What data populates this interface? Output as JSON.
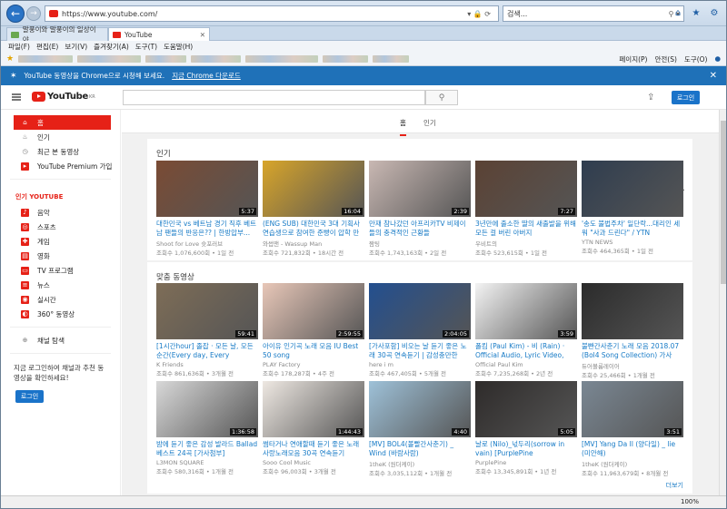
{
  "browser": {
    "url": "https://www.youtube.com/",
    "search_placeholder": "검색...",
    "tabs": [
      {
        "label": "말풍이와 말풍이의 일상이야..."
      },
      {
        "label": "YouTube"
      }
    ],
    "menu": [
      "파일(F)",
      "편집(E)",
      "보기(V)",
      "즐겨찾기(A)",
      "도구(T)",
      "도움말(H)"
    ],
    "favorites_tools": [
      "페이지(P)",
      "안전(S)",
      "도구(O)"
    ],
    "zoom": "100%"
  },
  "chrome_banner": {
    "text": "YouTube 동영상을 Chrome으로 시청해 보세요.",
    "link": "지금 Chrome 다운로드"
  },
  "header": {
    "logo": "YouTube",
    "logo_region": "KR",
    "login": "로그인"
  },
  "sidebar": {
    "main_items": [
      {
        "label": "홈",
        "icon": "home-icon"
      },
      {
        "label": "인기",
        "icon": "fire-icon"
      },
      {
        "label": "최근 본 동영상",
        "icon": "history-icon"
      },
      {
        "label": "YouTube Premium 가입",
        "icon": "youtube-icon"
      }
    ],
    "section_title": "인기 YOUTUBE",
    "popular_items": [
      {
        "label": "음악",
        "icon": "music-icon"
      },
      {
        "label": "스포츠",
        "icon": "sports-icon"
      },
      {
        "label": "게임",
        "icon": "game-icon"
      },
      {
        "label": "영화",
        "icon": "film-icon"
      },
      {
        "label": "TV 프로그램",
        "icon": "tv-icon"
      },
      {
        "label": "뉴스",
        "icon": "news-icon"
      },
      {
        "label": "실시간",
        "icon": "live-icon"
      },
      {
        "label": "360° 동영상",
        "icon": "360-icon"
      }
    ],
    "browse_channels": "채널 탐색",
    "signin_text": "지금 로그인하여 채널과 추천 동영상을 확인하세요!",
    "signin_button": "로그인"
  },
  "home_tabs": [
    "홈",
    "인기"
  ],
  "sections": [
    {
      "title": "인기",
      "videos": [
        {
          "title": "대한민국 vs 베트남 경기 직후 베트남 팬들의 반응은?? | 한방압부...",
          "channel": "Shoot for Love 슛포러브",
          "meta": "조회수 1,076,600회 • 1일 전",
          "duration": "5:37",
          "color": "#7a4b34"
        },
        {
          "title": "(ENG SUB) 대한민국 3대 기획사 연습생으로 참여한 준빵이 압학 만남...",
          "channel": "와썹맨 - Wassup Man",
          "meta": "조회수 721,832회 • 18시간 전",
          "duration": "16:04",
          "color": "#d8a52a"
        },
        {
          "title": "만재 참나갔던 아프리카TV 비제이 들의 충격적인 근황들",
          "channel": "짬팅",
          "meta": "조회수 1,743,163회 • 2일 전",
          "duration": "2:39",
          "color": "#c9b8b3"
        },
        {
          "title": "3년만에 출소한 딸의 새출발을 위해 모든 걸 버린 아버지",
          "channel": "우비트의",
          "meta": "조회수 523,615회 • 1일 전",
          "duration": "7:27",
          "color": "#5b4234"
        },
        {
          "title": "'송도 불법주차' 일단락...대리인 세워 \"사과 드린다\" / YTN",
          "channel": "YTN NEWS",
          "meta": "조회수 464,365회 • 1일 전",
          "duration": "",
          "color": "#2f3d4f"
        }
      ]
    },
    {
      "title": "맞춤 동영상",
      "videos": [
        {
          "title": "[1시간hour] 졸잡 · 모든 날, 모든 순간(Every day, Every Moment) ...",
          "channel": "K Friends",
          "meta": "조회수 861,636회 • 3개월 전",
          "duration": "59:41",
          "color": "#7e6d57"
        },
        {
          "title": "아이유 인기곡 노래 모음 IU Best 50 song",
          "channel": "PLAY Factory",
          "meta": "조회수 178,287회 • 4주 전",
          "duration": "2:59:55",
          "color": "#e8c7b8"
        },
        {
          "title": "[가사포함] 비오는 날 듣기 좋은 노래 30곡 연속듣기 | 감성충만한 분...",
          "channel": "here i m",
          "meta": "조회수 467,405회 • 5개월 전",
          "duration": "2:04:05",
          "color": "#234f8f"
        },
        {
          "title": "폴킴 (Paul Kim) - 비 (Rain) · Official Audio, Lyric Video, ENG ...",
          "channel": "Official Paul Kim",
          "meta": "조회수 7,235,268회 • 2년 전",
          "duration": "3:59",
          "color": "#f3f3f3"
        },
        {
          "title": "불빤간사춘기 노래 모음 2018.07 (Bol4 Song Collection) 가사+37...",
          "channel": "듀어볼륨레이어",
          "meta": "조회수 25,466회 • 1개월 전",
          "duration": "",
          "color": "#2b2b2b"
        },
        {
          "title": "밤에 듣기 좋은 감성 발라드 Ballad 베스트 24곡 [가사첨부]",
          "channel": "L3MON SQUARE",
          "meta": "조회수 580,316회 • 1개월 전",
          "duration": "1:36:58",
          "color": "#d8d8d8"
        },
        {
          "title": "썸타거나 연애할때 듣기 좋은 노래 사랑노래모음 30곡 연속듣기",
          "channel": "Sooo Cool Music",
          "meta": "조회수 96,003회 • 3개월 전",
          "duration": "1:44:43",
          "color": "#eee8e2"
        },
        {
          "title": "[MV] BOL4(볼빨간사춘기) _ Wind (바람사람)",
          "channel": "1theK (원더케이)",
          "meta": "조회수 3,035,112회 • 1개월 전",
          "duration": "4:40",
          "color": "#9ec1d8"
        },
        {
          "title": "날로 (Nilo)_넋두리(sorrow in vain) [PurplePine Entertainment]",
          "channel": "PurplePine",
          "meta": "조회수 13,345,891회 • 1년 전",
          "duration": "5:05",
          "color": "#2e2b2a"
        },
        {
          "title": "[MV] Yang Da Il (양다일) _ lie (미안해)",
          "channel": "1theK (원더케이)",
          "meta": "조회수 11,963,679회 • 8개월 전",
          "duration": "3:51",
          "color": "#7a8793"
        }
      ],
      "more": "더보기"
    }
  ]
}
